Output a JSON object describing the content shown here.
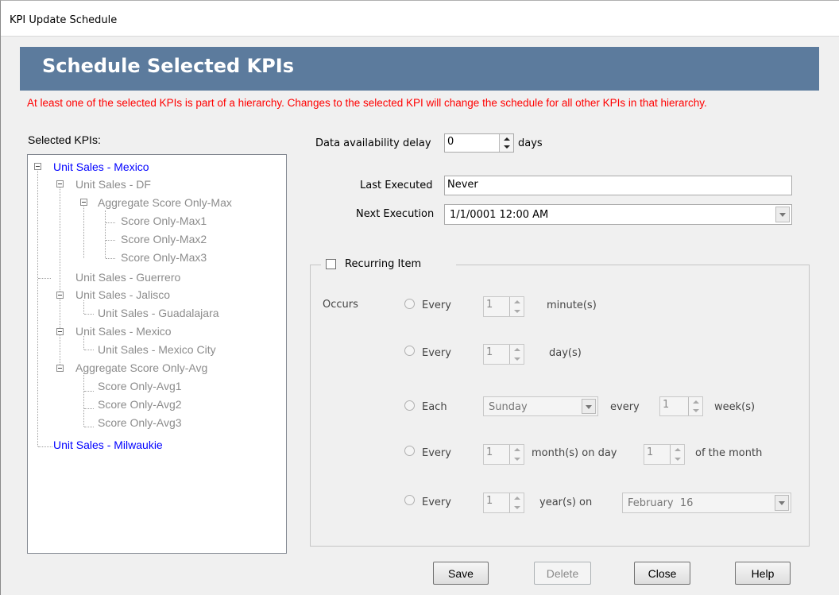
{
  "window": {
    "title": "KPI Update Schedule"
  },
  "banner": {
    "title": "Schedule Selected KPIs"
  },
  "warning": "At least one of the selected KPIs is part of a hierarchy. Changes to the selected KPI will change the schedule for all other KPIs in that hierarchy.",
  "tree": {
    "label": "Selected KPIs:",
    "nodes": [
      "Unit Sales - Mexico",
      "Unit Sales - DF",
      "Aggregate Score Only-Max",
      "Score Only-Max1",
      "Score Only-Max2",
      "Score Only-Max3",
      "Unit Sales - Guerrero",
      "Unit Sales - Jalisco",
      "Unit Sales - Guadalajara",
      "Unit Sales - Mexico",
      "Unit Sales - Mexico City",
      "Aggregate Score Only-Avg",
      "Score Only-Avg1",
      "Score Only-Avg2",
      "Score Only-Avg3",
      "Unit Sales - Milwaukie"
    ]
  },
  "delay": {
    "label": "Data availability delay",
    "value": "0",
    "unit": "days"
  },
  "last_executed": {
    "label": "Last Executed",
    "value": "Never"
  },
  "next_execution": {
    "label": "Next Execution",
    "value": "1/1/0001 12:00 AM"
  },
  "recurring": {
    "label": "Recurring Item",
    "checked": false,
    "occurs_label": "Occurs",
    "rows": {
      "minutes": {
        "radio": "Every",
        "value": "1",
        "unit": "minute(s)"
      },
      "days": {
        "radio": "Every",
        "value": "1",
        "unit": "day(s)"
      },
      "weeks": {
        "radio": "Each",
        "day": "Sunday",
        "every": "every",
        "value": "1",
        "unit": "week(s)"
      },
      "months": {
        "radio": "Every",
        "value": "1",
        "mid": "month(s) on day",
        "day": "1",
        "unit": "of the month"
      },
      "years": {
        "radio": "Every",
        "value": "1",
        "mid": "year(s) on",
        "date": "February  16"
      }
    }
  },
  "buttons": {
    "save": "Save",
    "delete": "Delete",
    "close": "Close",
    "help": "Help"
  }
}
